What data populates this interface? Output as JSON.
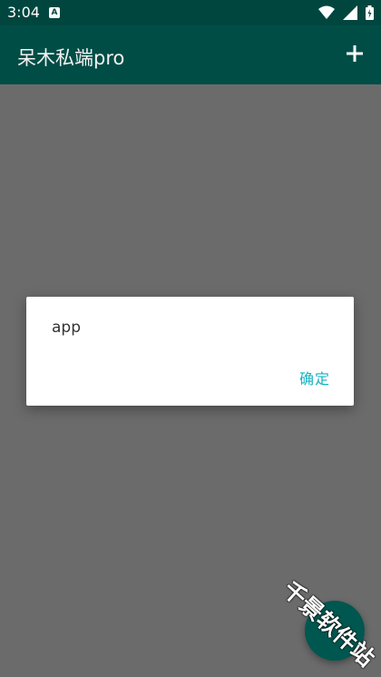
{
  "status_bar": {
    "time": "3:04",
    "notification_icon": "a-icon"
  },
  "app_bar": {
    "title": "呆木私端pro",
    "action_icon": "plus-icon"
  },
  "dialog": {
    "message": "app",
    "ok_label": "确定"
  },
  "watermark": {
    "text": "千景软件站"
  },
  "colors": {
    "status_bar": "#00463f",
    "app_bar": "#004d46",
    "scrim": "#6b6b6b",
    "dialog_bg": "#ffffff",
    "dialog_button": "#12b3c4",
    "fab": "#00574f"
  }
}
